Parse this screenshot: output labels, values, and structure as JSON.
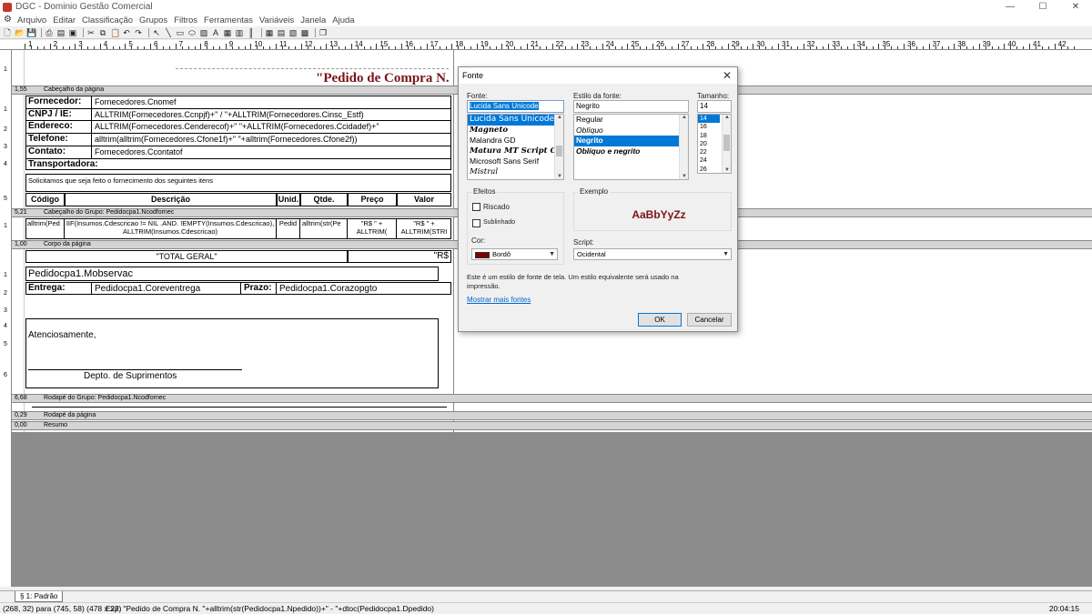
{
  "window": {
    "title": "DGC - Dominio Gestão Comercial"
  },
  "menu": [
    "Arquivo",
    "Editar",
    "Classificação",
    "Grupos",
    "Filtros",
    "Ferramentas",
    "Variáveis",
    "Janela",
    "Ajuda"
  ],
  "ruler": {
    "h_labels": [
      "1",
      "2",
      "3",
      "4",
      "5",
      "6",
      "7",
      "8",
      "9",
      "10",
      "11",
      "12",
      "13",
      "14",
      "15",
      "16",
      "17",
      "18",
      "19",
      "20",
      "21",
      "22",
      "23",
      "24",
      "25",
      "26",
      "27",
      "28",
      "29",
      "30",
      "31",
      "32",
      "33",
      "34",
      "35",
      "36",
      "37",
      "38",
      "39",
      "40",
      "41",
      "42"
    ]
  },
  "bands": {
    "page_header": {
      "height": "1,55",
      "name": "Cabeçalho da página"
    },
    "group_header": {
      "height": "5,21",
      "name": "Cabeçalho do Grupo: Pedidocpa1.Ncodfornec"
    },
    "body": {
      "height": "1,00",
      "name": "Corpo da página"
    },
    "group_footer": {
      "height": "6,68",
      "name": "Rodapé do Grupo: Pedidocpa1.Ncodfornec"
    },
    "page_footer": {
      "height": "0,29",
      "name": "Rodapé da página"
    },
    "summary": {
      "height": "0,00",
      "name": "Resumo"
    }
  },
  "report": {
    "title_text": "\"Pedido de Compra N.",
    "rows": [
      {
        "label": "Fornecedor:",
        "field": "Fornecedores.Cnomef"
      },
      {
        "label": "CNPJ / IE:",
        "field": "ALLTRIM(Fornecedores.Ccnpjf)+\"   /   \"+ALLTRIM(Fornecedores.Cinsc_Estf)"
      },
      {
        "label": "Endereco:",
        "field": "ALLTRIM(Fornecedores.Cenderecof)+\"   \"+ALLTRIM(Fornecedores.Ccidadef)+\""
      },
      {
        "label": "Telefone:",
        "field": "alltrim(alltrim(Fornecedores.Cfone1f)+\"   \"+alltrim(Fornecedores.Cfone2f))"
      },
      {
        "label": "Contato:",
        "field": "Fornecedores.Ccontatof"
      },
      {
        "label": "Transportadora:",
        "field": ""
      }
    ],
    "intro_text": "Solicitamos que seja feito o fornecimento dos seguintes itens",
    "table_headers": [
      "Código",
      "Descrição",
      "Unid.",
      "Qtde.",
      "Preço",
      "Valor"
    ],
    "detail": [
      "alltrim(Ped",
      "IIF(Insumos.Cdescricao != NIL .AND. !EMPTY(Insumos.Cdescricao), ALLTRIM(Insumos.Cdescricao)",
      "Pedid",
      "alltrim(str(Pe",
      "\"R$ \" + ALLTRIM(",
      "\"R$ \" + ALLTRIM(STRI"
    ],
    "total_label": "\"TOTAL GERAL\"",
    "total_value": "\"R$",
    "obs_field": "Pedidocpa1.Mobservac",
    "entrega_label": "Entrega:",
    "entrega_field": "Pedidocpa1.Coreventrega",
    "prazo_label": "Prazo:",
    "prazo_field": "Pedidocpa1.Corazopgto",
    "closing": "Atenciosamente,",
    "signature": "Depto. de Suprimentos"
  },
  "dialog": {
    "title": "Fonte",
    "font_label": "Fonte:",
    "font_value": "Lucida Sans Unicode",
    "font_list": [
      "Lucida Sans Unicode",
      "Magneto",
      "Malandra GD",
      "Matura MT Script Capitals",
      "Microsoft Sans Serif",
      "Mistral"
    ],
    "style_label": "Estilo da fonte:",
    "style_value": "Negrito",
    "style_list": [
      "Regular",
      "Oblíquo",
      "Negrito",
      "Oblíquo e negrito"
    ],
    "size_label": "Tamanho:",
    "size_value": "14",
    "size_list": [
      "14",
      "16",
      "18",
      "20",
      "22",
      "24",
      "26"
    ],
    "effects_label": "Efeitos",
    "strike_label": "Riscado",
    "underline_label": "Sublinhado",
    "color_label": "Cor:",
    "color_value": "Bordô",
    "color_swatch": "#800000",
    "sample_label": "Exemplo",
    "sample_text": "AaBbYyZz",
    "script_label": "Script:",
    "script_value": "Ocidental",
    "info_text": "Este é um estilo de fonte de tela. Um estilo equivalente será usado na impressão.",
    "more_fonts": "Mostrar mais fontes",
    "ok": "OK",
    "cancel": "Cancelar"
  },
  "tabs": {
    "page_tab": "§ 1: Padrão"
  },
  "status": {
    "coords": "(268, 32) para (745, 58)  (478 x 27)",
    "expr": "Exp: \"Pedido de Compra N. \"+alltrim(str(Pedidocpa1.Npedido))+\" - \"+dtoc(Pedidocpa1.Dpedido)",
    "time": "20:04:15"
  }
}
